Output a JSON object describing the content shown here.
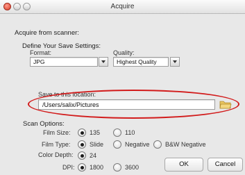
{
  "window": {
    "title": "Acquire"
  },
  "section": {
    "heading": "Acquire from scanner:"
  },
  "save_settings": {
    "heading": "Define Your Save Settings:",
    "format_label": "Format:",
    "format_value": "JPG",
    "quality_label": "Quality:",
    "quality_value": "Highest Quality"
  },
  "location": {
    "label": "Save to this location:",
    "path": "/Users/salix/Pictures"
  },
  "scan_options": {
    "heading": "Scan Options:",
    "film_size_label": "Film Size:",
    "film_size_options": [
      "135",
      "110"
    ],
    "film_type_label": "Film Type:",
    "film_type_options": [
      "Slide",
      "Negative",
      "B&W Negative"
    ],
    "color_depth_label": "Color Depth:",
    "color_depth_options": [
      "24"
    ],
    "dpi_label": "DPI:",
    "dpi_options": [
      "1800",
      "3600"
    ]
  },
  "buttons": {
    "ok": "OK",
    "cancel": "Cancel"
  },
  "colors": {
    "highlight_ring": "#d21b1b"
  },
  "icons": {
    "folder": "folder-icon"
  }
}
